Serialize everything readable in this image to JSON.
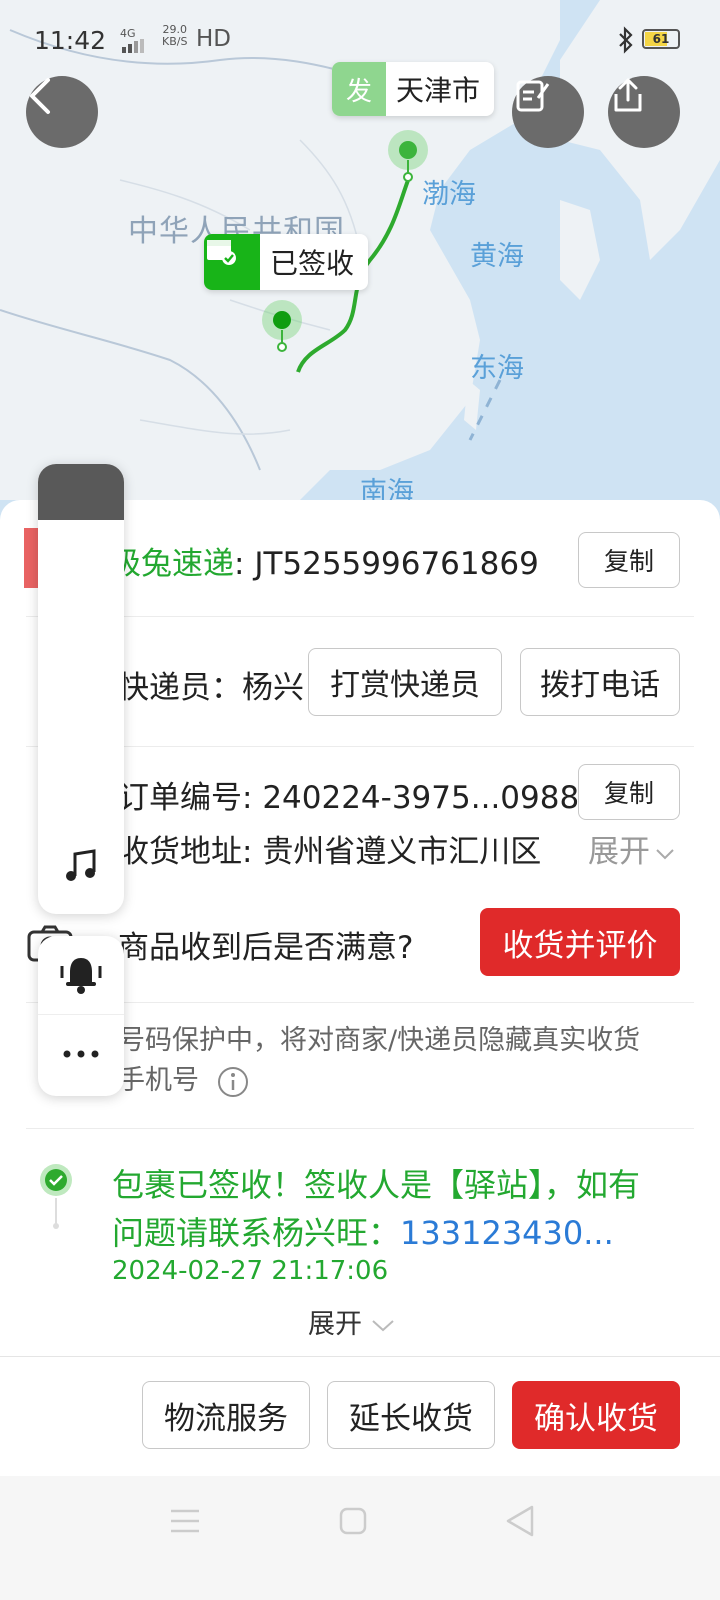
{
  "status_bar": {
    "time": "11:42",
    "network": "4G",
    "speed_value": "29.0",
    "speed_unit": "KB/S",
    "hd": "HD",
    "battery": "61"
  },
  "map": {
    "origin_tag": "发",
    "origin_city": "天津市",
    "signed_label": "已签收",
    "country": "中华人民共和国",
    "seas": {
      "bohai": "渤海",
      "huanghai": "黄海",
      "donghai": "东海",
      "nanhai": "南海"
    }
  },
  "shipment": {
    "carrier": "极兔速递",
    "separator": ": ",
    "tracking_no": "JT5255996761869",
    "copy_label": "复制"
  },
  "courier": {
    "label": "快递员：",
    "name": "杨兴",
    "tip_button": "打赏快递员",
    "call_button": "拨打电话"
  },
  "order": {
    "number_label": "订单编号: ",
    "number": "240224-3975...0988",
    "copy_label": "复制",
    "address_label": "收货地址: ",
    "address": "贵州省遵义市汇川区",
    "expand_label": "展开"
  },
  "satisfaction": {
    "question": "商品收到后是否满意?",
    "button": "收货并评价"
  },
  "privacy": {
    "text_line1": "号码保护中，将对商家/快递员隐藏真实收货",
    "text_line2": "手机号"
  },
  "tracking": {
    "message_line1": "包裹已签收！签收人是【驿站】，如有",
    "message_line2_prefix": "问题请联系杨兴旺：",
    "phone": "133123430...",
    "timestamp": "2024-02-27 21:17:06",
    "expand_label": "展开"
  },
  "actions": {
    "logistics_service": "物流服务",
    "extend_receipt": "延长收货",
    "confirm_receipt": "确认收货"
  },
  "colors": {
    "accent_green": "#23a830",
    "red": "#e02a2a",
    "blue": "#2b7bd6"
  },
  "icons": [
    "back-icon",
    "edit-note-icon",
    "share-icon",
    "music-icon",
    "bell-icon",
    "more-icon",
    "info-icon",
    "check-icon",
    "chevron-down-icon",
    "menu-nav-icon",
    "home-nav-icon",
    "back-nav-icon"
  ]
}
